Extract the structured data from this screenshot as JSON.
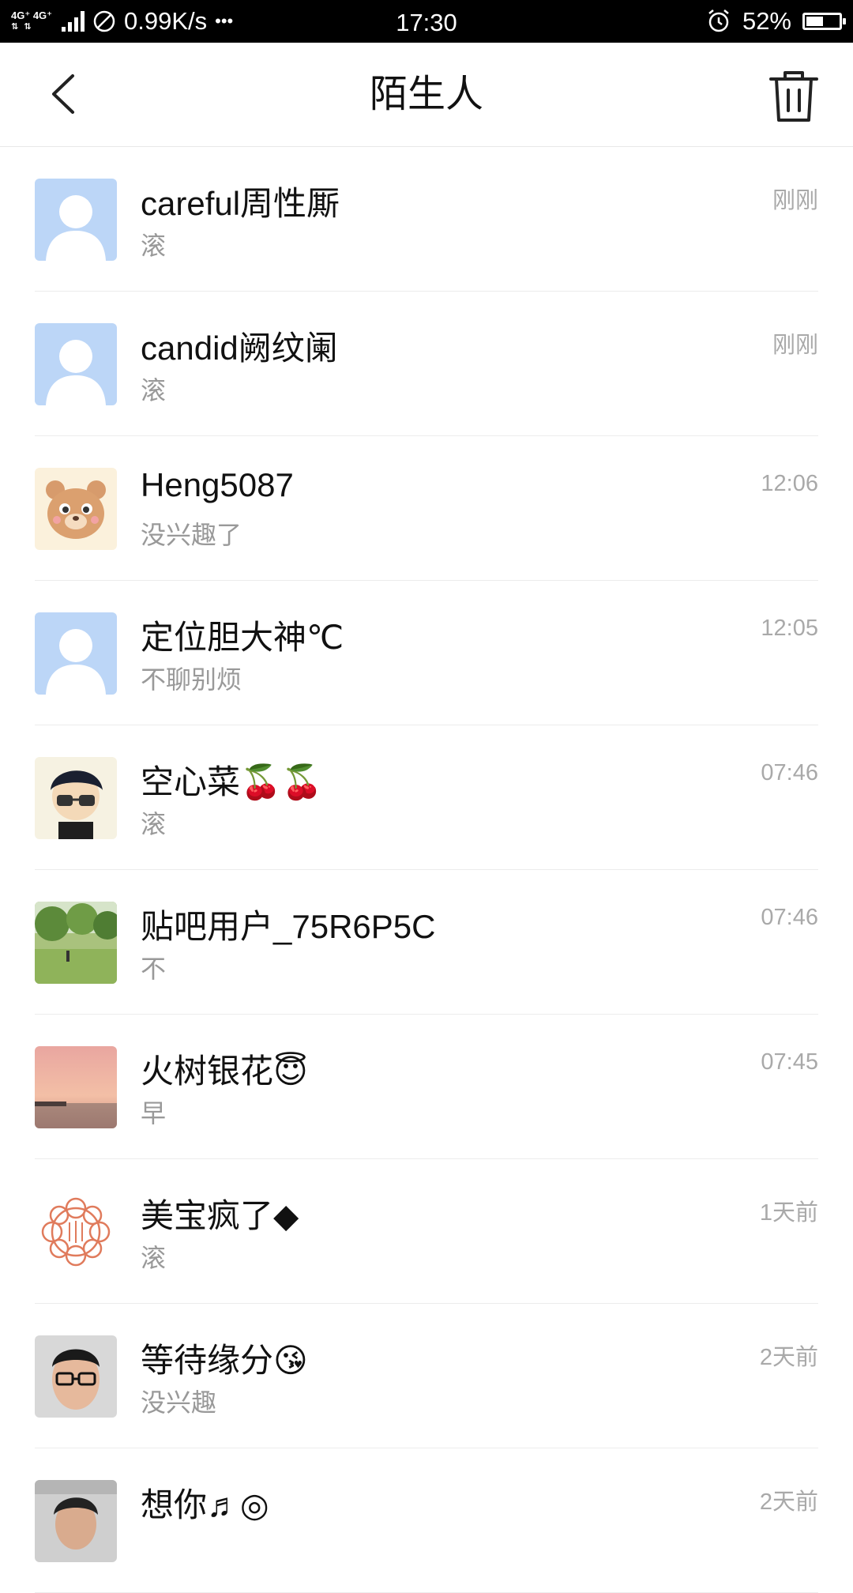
{
  "status_bar": {
    "network_top": "4G⁺ 4G⁺",
    "speed": "0.99K/s",
    "dots": "•••",
    "time": "17:30",
    "battery": "52%",
    "battery_level": 0.52
  },
  "header": {
    "title": "陌生人",
    "back_icon": "chevron-left-icon",
    "trash_icon": "trash-icon"
  },
  "conversations": [
    {
      "name": "careful周性厮",
      "message": "滚",
      "time": "刚刚",
      "avatar": "default-avatar"
    },
    {
      "name": "candid阙纹阑",
      "message": "滚",
      "time": "刚刚",
      "avatar": "default-avatar"
    },
    {
      "name": "Heng5087",
      "message": "没兴趣了",
      "time": "12:06",
      "avatar": "bear-avatar"
    },
    {
      "name": "定位胆大神℃",
      "message": "不聊别烦",
      "time": "12:05",
      "avatar": "default-avatar"
    },
    {
      "name": "空心菜🍒🍒",
      "message": "滚",
      "time": "07:46",
      "avatar": "cartoon-boy-avatar"
    },
    {
      "name": "贴吧用户_75R6P5C",
      "message": "不",
      "time": "07:46",
      "avatar": "park-photo-avatar"
    },
    {
      "name": "火树银花😇",
      "message": "早",
      "time": "07:45",
      "avatar": "sunset-photo-avatar"
    },
    {
      "name": "美宝疯了◆",
      "message": "滚",
      "time": "1天前",
      "avatar": "flower-stamp-avatar"
    },
    {
      "name": "等待缘分😘",
      "message": "没兴趣",
      "time": "2天前",
      "avatar": "man-glasses-avatar"
    },
    {
      "name": "想你♬◎",
      "message": "",
      "time": "2天前",
      "avatar": "man-photo-avatar"
    }
  ]
}
